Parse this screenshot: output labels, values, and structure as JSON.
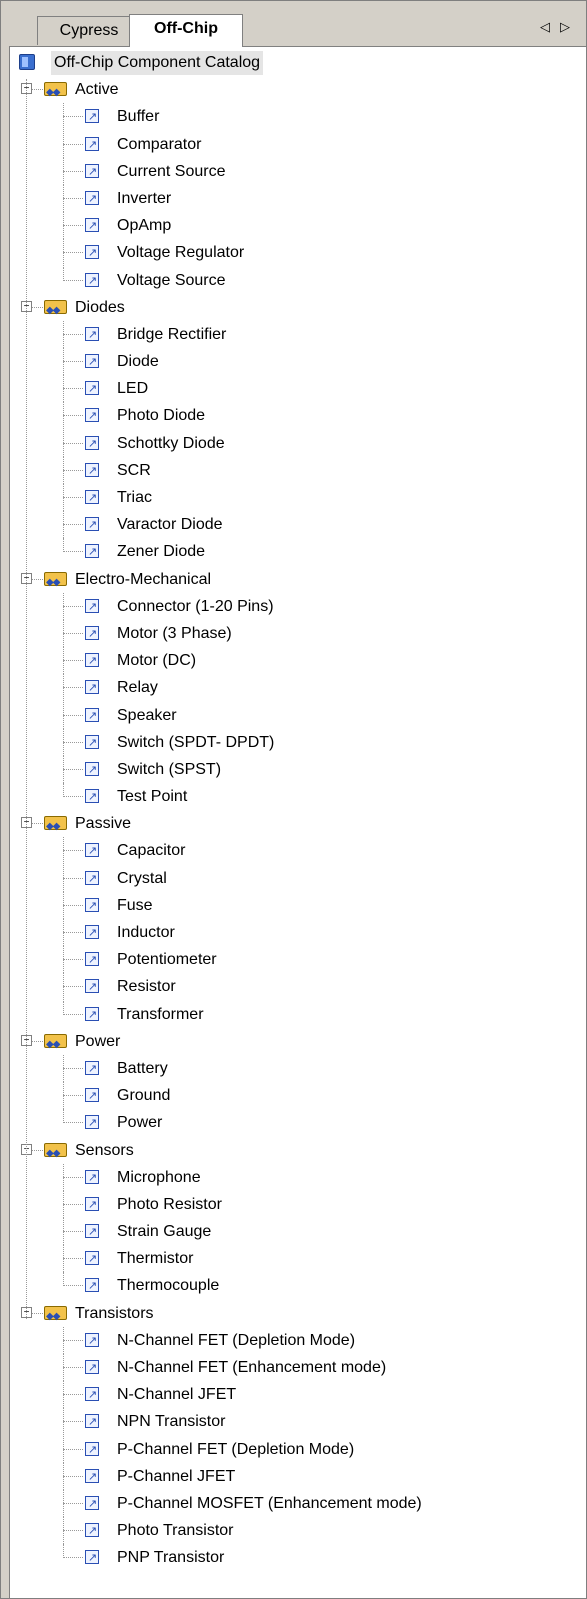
{
  "tabs": [
    {
      "label": "Cypress",
      "active": false
    },
    {
      "label": "Off-Chip",
      "active": true
    }
  ],
  "tab_nav": {
    "left": "◁",
    "right": "▷"
  },
  "tree": {
    "root_label": "Off-Chip Component Catalog",
    "categories": [
      {
        "label": "Active",
        "items": [
          "Buffer",
          "Comparator",
          "Current Source",
          "Inverter",
          "OpAmp",
          "Voltage Regulator",
          "Voltage Source"
        ]
      },
      {
        "label": "Diodes",
        "items": [
          "Bridge Rectifier",
          "Diode",
          "LED",
          "Photo Diode",
          "Schottky Diode",
          "SCR",
          "Triac",
          "Varactor Diode",
          "Zener Diode"
        ]
      },
      {
        "label": "Electro-Mechanical",
        "items": [
          "Connector (1-20 Pins)",
          "Motor (3 Phase)",
          "Motor (DC)",
          "Relay",
          "Speaker",
          "Switch (SPDT- DPDT)",
          "Switch (SPST)",
          "Test Point"
        ]
      },
      {
        "label": "Passive",
        "items": [
          "Capacitor",
          "Crystal",
          "Fuse",
          "Inductor",
          "Potentiometer",
          "Resistor",
          "Transformer"
        ]
      },
      {
        "label": "Power",
        "items": [
          "Battery",
          "Ground",
          "Power"
        ]
      },
      {
        "label": "Sensors",
        "items": [
          "Microphone",
          "Photo Resistor",
          "Strain Gauge",
          "Thermistor",
          "Thermocouple"
        ]
      },
      {
        "label": "Transistors",
        "items": [
          "N-Channel FET (Depletion Mode)",
          "N-Channel FET (Enhancement mode)",
          "N-Channel JFET",
          "NPN Transistor",
          "P-Channel FET (Depletion Mode)",
          "P-Channel JFET",
          "P-Channel MOSFET (Enhancement mode)",
          "Photo Transistor",
          "PNP Transistor"
        ]
      }
    ]
  }
}
